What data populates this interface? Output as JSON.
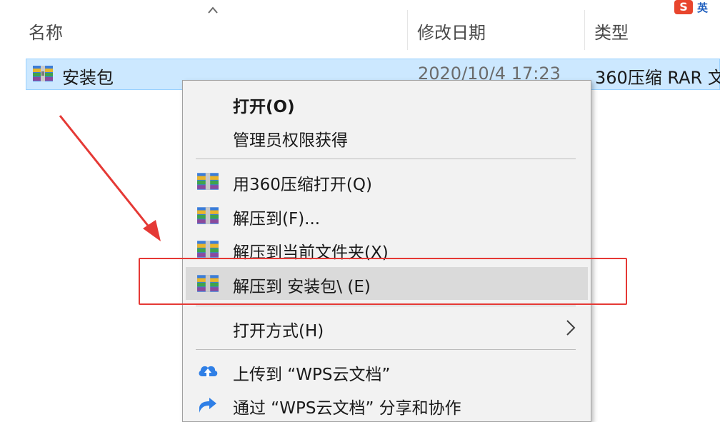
{
  "columns": {
    "name": "名称",
    "modified": "修改日期",
    "type": "类型"
  },
  "file": {
    "name": "安装包",
    "modified": "2020/10/4 17:23",
    "type": "360压缩 RAR 文"
  },
  "ime": {
    "badge": "S",
    "mode": "英"
  },
  "context_menu": {
    "open": "打开(O)",
    "admin": "管理员权限获得",
    "open_360": "用360压缩打开(Q)",
    "extract_to": "解压到(F)...",
    "extract_here": "解压到当前文件夹(X)",
    "extract_folder": "解压到 安装包\\ (E)",
    "open_with": "打开方式(H)",
    "upload_wps": "上传到 “WPS云文档”",
    "share_wps": "通过 “WPS云文档” 分享和协作"
  },
  "colors": {
    "selection": "#cce8ff",
    "highlight_box": "#e53935",
    "menu_hover": "#dadada"
  }
}
